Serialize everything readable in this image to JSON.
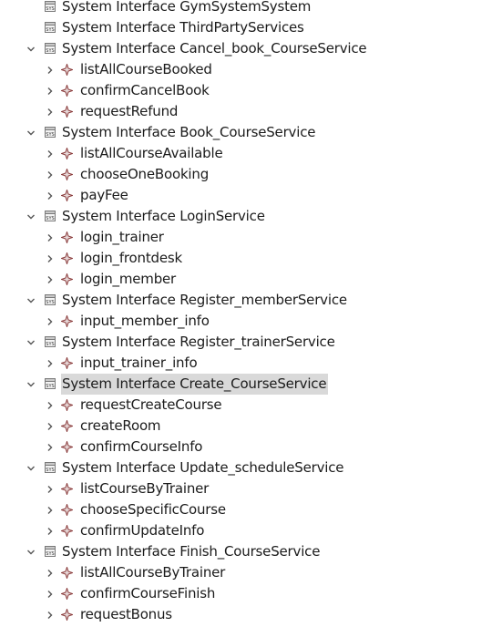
{
  "tree": [
    {
      "label": "System Interface GymSystemSystem",
      "expanded": null
    },
    {
      "label": "System Interface ThirdPartyServices",
      "expanded": null
    },
    {
      "label": "System Interface Cancel_book_CourseService",
      "expanded": true,
      "children": [
        "listAllCourseBooked",
        "confirmCancelBook",
        "requestRefund"
      ]
    },
    {
      "label": "System Interface Book_CourseService",
      "expanded": true,
      "children": [
        "listAllCourseAvailable",
        "chooseOneBooking",
        "payFee"
      ]
    },
    {
      "label": "System Interface LoginService",
      "expanded": true,
      "children": [
        "login_trainer",
        "login_frontdesk",
        "login_member"
      ]
    },
    {
      "label": "System Interface Register_memberService",
      "expanded": true,
      "children": [
        "input_member_info"
      ]
    },
    {
      "label": "System Interface Register_trainerService",
      "expanded": true,
      "children": [
        "input_trainer_info"
      ]
    },
    {
      "label": "System Interface Create_CourseService",
      "expanded": true,
      "selected": true,
      "children": [
        "requestCreateCourse",
        "createRoom",
        "confirmCourseInfo"
      ]
    },
    {
      "label": "System Interface Update_scheduleService",
      "expanded": true,
      "children": [
        "listCourseByTrainer",
        "chooseSpecificCourse",
        "confirmUpdateInfo"
      ]
    },
    {
      "label": "System Interface Finish_CourseService",
      "expanded": true,
      "children": [
        "listAllCourseByTrainer",
        "confirmCourseFinish",
        "requestBonus"
      ]
    }
  ],
  "icons": {
    "interface": "interface-file-icon",
    "operation": "operation-diamond-icon",
    "expanded": "chevron-down-icon",
    "collapsed": "chevron-right-icon"
  },
  "colors": {
    "selection": "#d9d9d9",
    "text": "#1b1b1b",
    "twisty": "#555555",
    "operation_icon": "#8a3b3b"
  }
}
